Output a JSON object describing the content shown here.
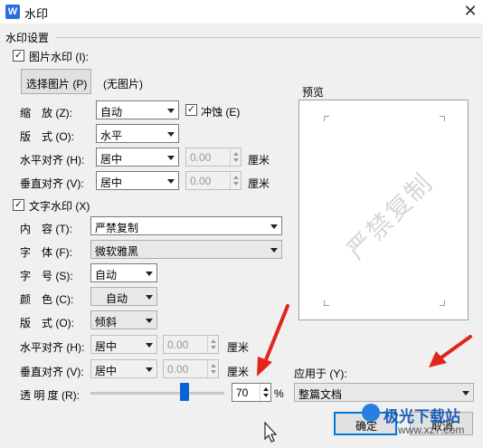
{
  "window": {
    "app_icon": "W",
    "title": "水印"
  },
  "section": {
    "label": "水印设置"
  },
  "picture": {
    "checkbox_label": "图片水印 (I):",
    "choose_button": "选择图片 (P)",
    "no_picture": "(无图片)",
    "scale_label": "缩　放 (Z):",
    "scale_value": "自动",
    "washout_label": "冲蚀 (E)",
    "layout_label": "版　式 (O):",
    "layout_value": "水平",
    "halign_label": "水平对齐 (H):",
    "halign_value": "居中",
    "halign_offset": "0.00",
    "valign_label": "垂直对齐 (V):",
    "valign_value": "居中",
    "valign_offset": "0.00",
    "unit": "厘米"
  },
  "text": {
    "checkbox_label": "文字水印 (X)",
    "content_label": "内　容 (T):",
    "content_value": "严禁复制",
    "font_label": "字　体 (F):",
    "font_value": "微软雅黑",
    "size_label": "字　号 (S):",
    "size_value": "自动",
    "color_label": "颜　色 (C):",
    "color_value": "自动",
    "layout_label": "版　式 (O):",
    "layout_value": "倾斜",
    "halign_label": "水平对齐 (H):",
    "halign_value": "居中",
    "halign_offset": "0.00",
    "valign_label": "垂直对齐 (V):",
    "valign_value": "居中",
    "valign_offset": "0.00",
    "unit": "厘米",
    "transparency_label": "透 明 度 (R):",
    "transparency_value": "70",
    "transparency_unit": "%",
    "transparency_level": 70
  },
  "preview": {
    "label": "预览",
    "watermark_text": "严禁复制"
  },
  "apply": {
    "label": "应用于 (Y):",
    "value": "整篇文档"
  },
  "buttons": {
    "ok": "确定",
    "cancel": "取消"
  },
  "logo": {
    "text": "极光下载站",
    "url": "www.xz7.com"
  },
  "colors": {
    "accent": "#0078d7",
    "slider_thumb": "#0a64d6",
    "arrow": "#e0251c"
  }
}
